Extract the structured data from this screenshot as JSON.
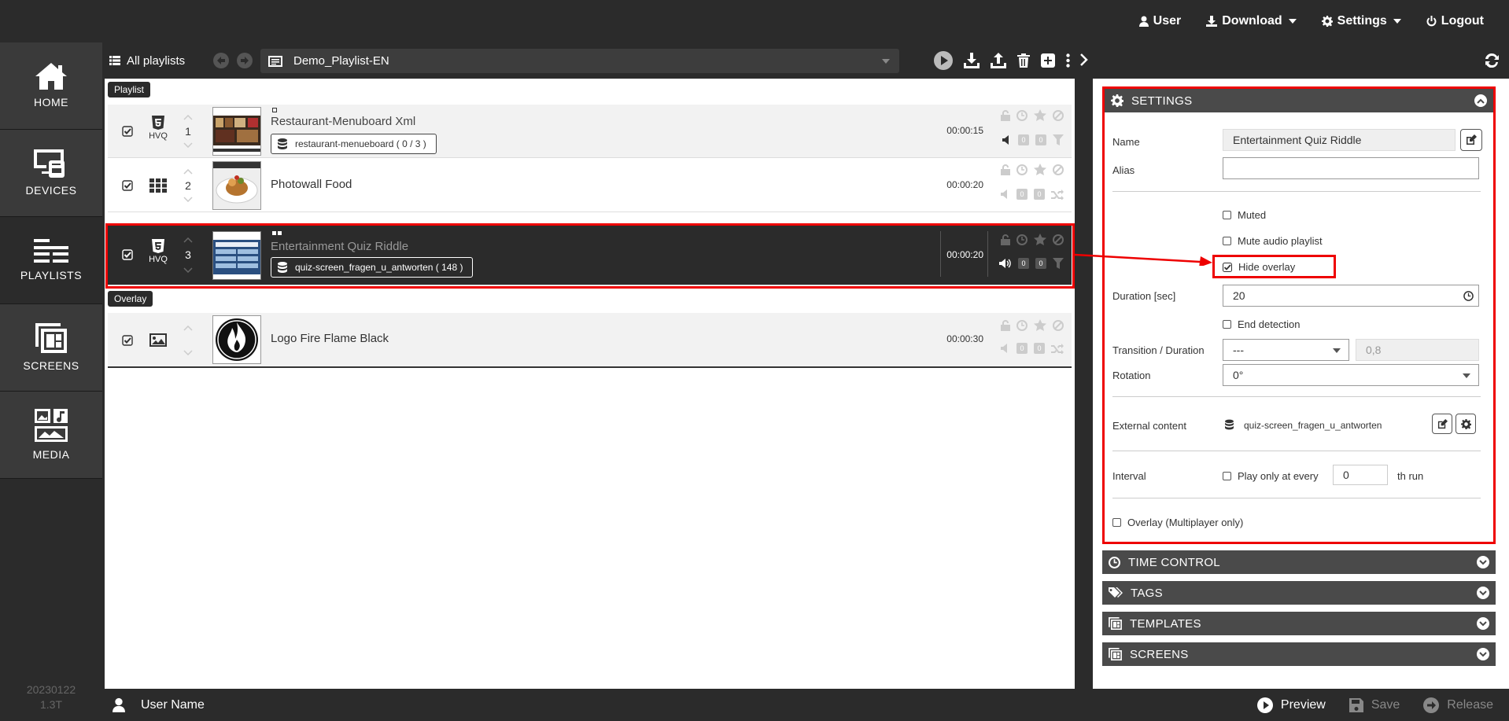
{
  "topnav": {
    "user": "User",
    "download": "Download",
    "settings": "Settings",
    "logout": "Logout"
  },
  "sidebar": {
    "items": [
      {
        "label": "HOME"
      },
      {
        "label": "DEVICES"
      },
      {
        "label": "PLAYLISTS"
      },
      {
        "label": "SCREENS"
      },
      {
        "label": "MEDIA"
      }
    ],
    "version_line1": "20230122",
    "version_line2": "1.3T"
  },
  "toolbar": {
    "all_playlists": "All playlists",
    "playlist_name": "Demo_Playlist-EN"
  },
  "playlist": {
    "section_playlist": "Playlist",
    "section_overlay": "Overlay",
    "rows": [
      {
        "num": "1",
        "type": "HTML5",
        "type_sub": "HVQ",
        "title": "Restaurant-Menuboard Xml",
        "datasource": "restaurant-menueboard ( 0 / 3 )",
        "duration": "00:00:15"
      },
      {
        "num": "2",
        "type": "grid",
        "type_sub": "",
        "title": "Photowall Food",
        "datasource": "",
        "duration": "00:00:20"
      },
      {
        "num": "3",
        "type": "HTML5",
        "type_sub": "HVQ",
        "title": "Entertainment Quiz Riddle",
        "datasource": "quiz-screen_fragen_u_antworten ( 148 )",
        "duration": "00:00:20",
        "selected": true
      }
    ],
    "overlay_rows": [
      {
        "title": "Logo Fire Flame Black",
        "duration": "00:00:30"
      }
    ],
    "badge_zero": "0"
  },
  "settings": {
    "header": "SETTINGS",
    "name_label": "Name",
    "name_value": "Entertainment Quiz Riddle",
    "alias_label": "Alias",
    "alias_value": "",
    "muted_label": "Muted",
    "mute_audio_label": "Mute audio playlist",
    "hide_overlay_label": "Hide overlay",
    "duration_label": "Duration [sec]",
    "duration_value": "20",
    "end_detection_label": "End detection",
    "transition_label": "Transition / Duration",
    "transition_value": "---",
    "transition_duration": "0,8",
    "rotation_label": "Rotation",
    "rotation_value": "0°",
    "external_label": "External content",
    "external_value": "quiz-screen_fragen_u_antworten",
    "interval_label": "Interval",
    "play_only_label": "Play only at every",
    "interval_value": "0",
    "th_run_label": "th run",
    "overlay_multi_label": "Overlay (Multiplayer only)"
  },
  "accordions": [
    {
      "label": "TIME CONTROL"
    },
    {
      "label": "TAGS"
    },
    {
      "label": "TEMPLATES"
    },
    {
      "label": "SCREENS"
    }
  ],
  "bottombar": {
    "username": "User Name",
    "preview": "Preview",
    "save": "Save",
    "release": "Release"
  },
  "colors": {
    "dark": "#2b2b2b",
    "panel_header": "#4a4a4a",
    "highlight": "#e00000"
  }
}
